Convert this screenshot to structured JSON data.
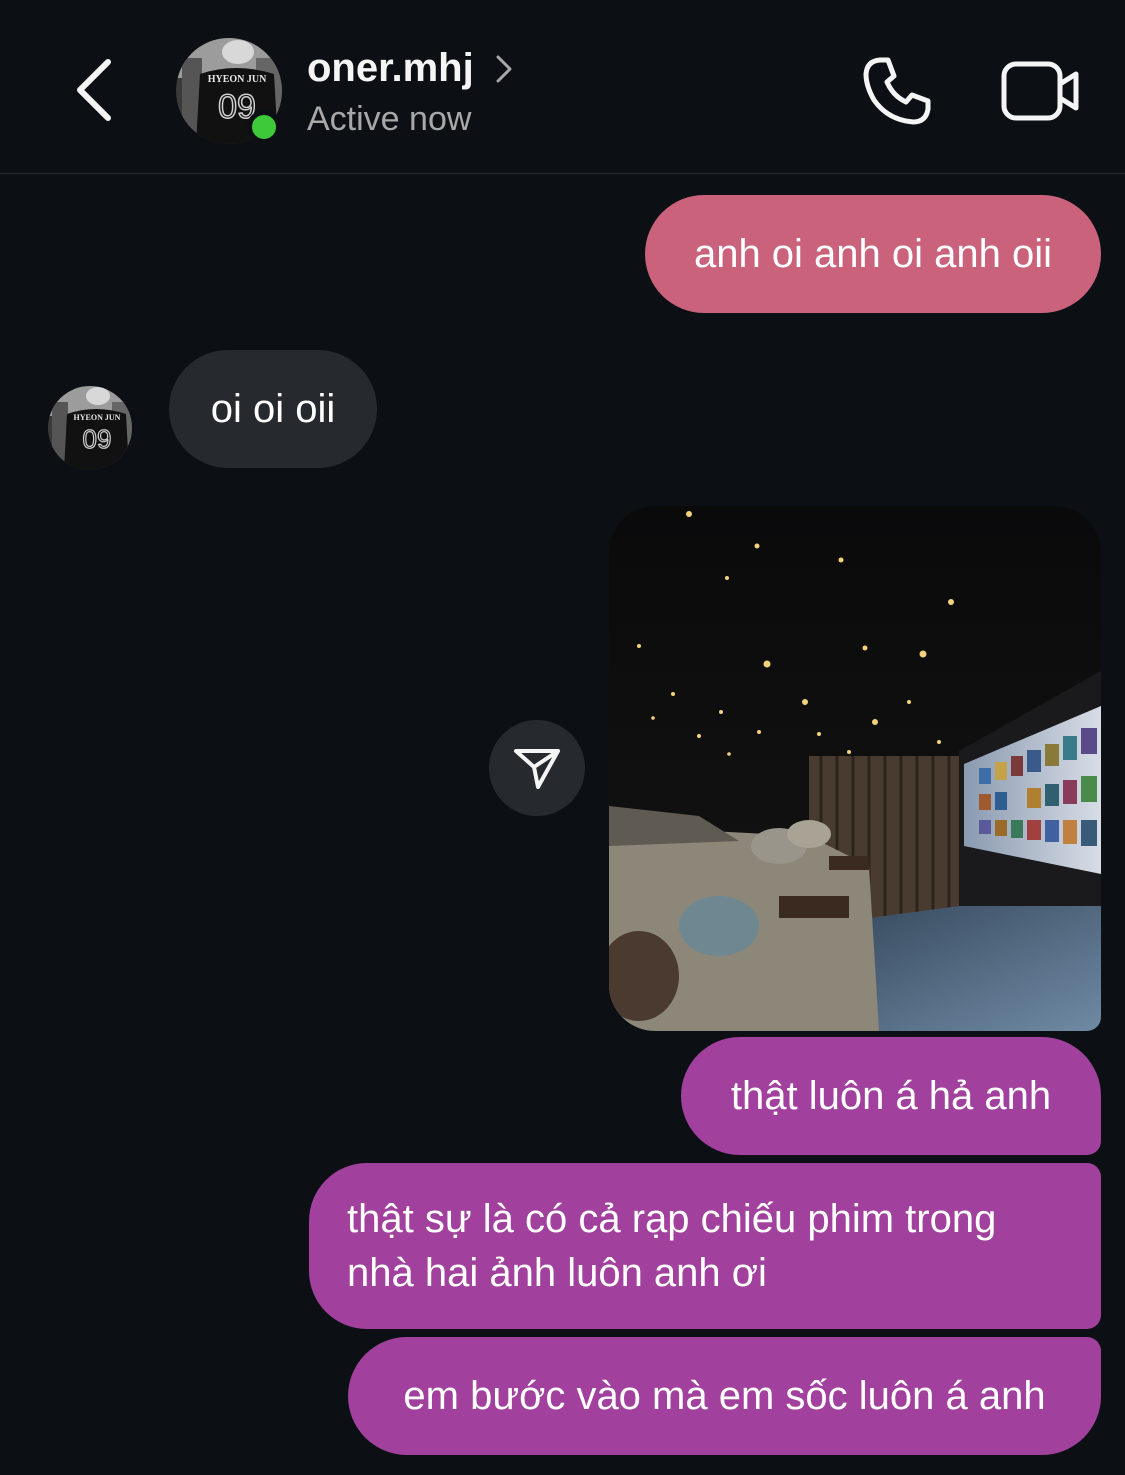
{
  "header": {
    "username": "oner.mhj",
    "status": "Active now",
    "avatar_jersey_name": "HYEON JUN",
    "avatar_jersey_number": "09"
  },
  "messages": [
    {
      "from": "me",
      "text": "anh oi anh oi anh oii"
    },
    {
      "from": "them",
      "text": "oi oi oii"
    },
    {
      "from": "me",
      "type": "image",
      "description": "home theater room"
    },
    {
      "from": "me",
      "text": "thật luôn á hả anh"
    },
    {
      "from": "me",
      "lines": [
        "thật sự là có cả rạp chiếu phim trong",
        "nhà hai ảnh luôn anh ơi"
      ]
    },
    {
      "from": "me",
      "text": "em bước vào mà em sốc luôn á anh"
    }
  ],
  "colors": {
    "background": "#0c1014",
    "outgoing_pink": "#c9627a",
    "outgoing_purple": "#a2409e",
    "incoming": "#262a2e",
    "online": "#3ec93b"
  },
  "icons": [
    "back-arrow-icon",
    "chevron-right-icon",
    "phone-icon",
    "video-camera-icon",
    "send-icon"
  ]
}
